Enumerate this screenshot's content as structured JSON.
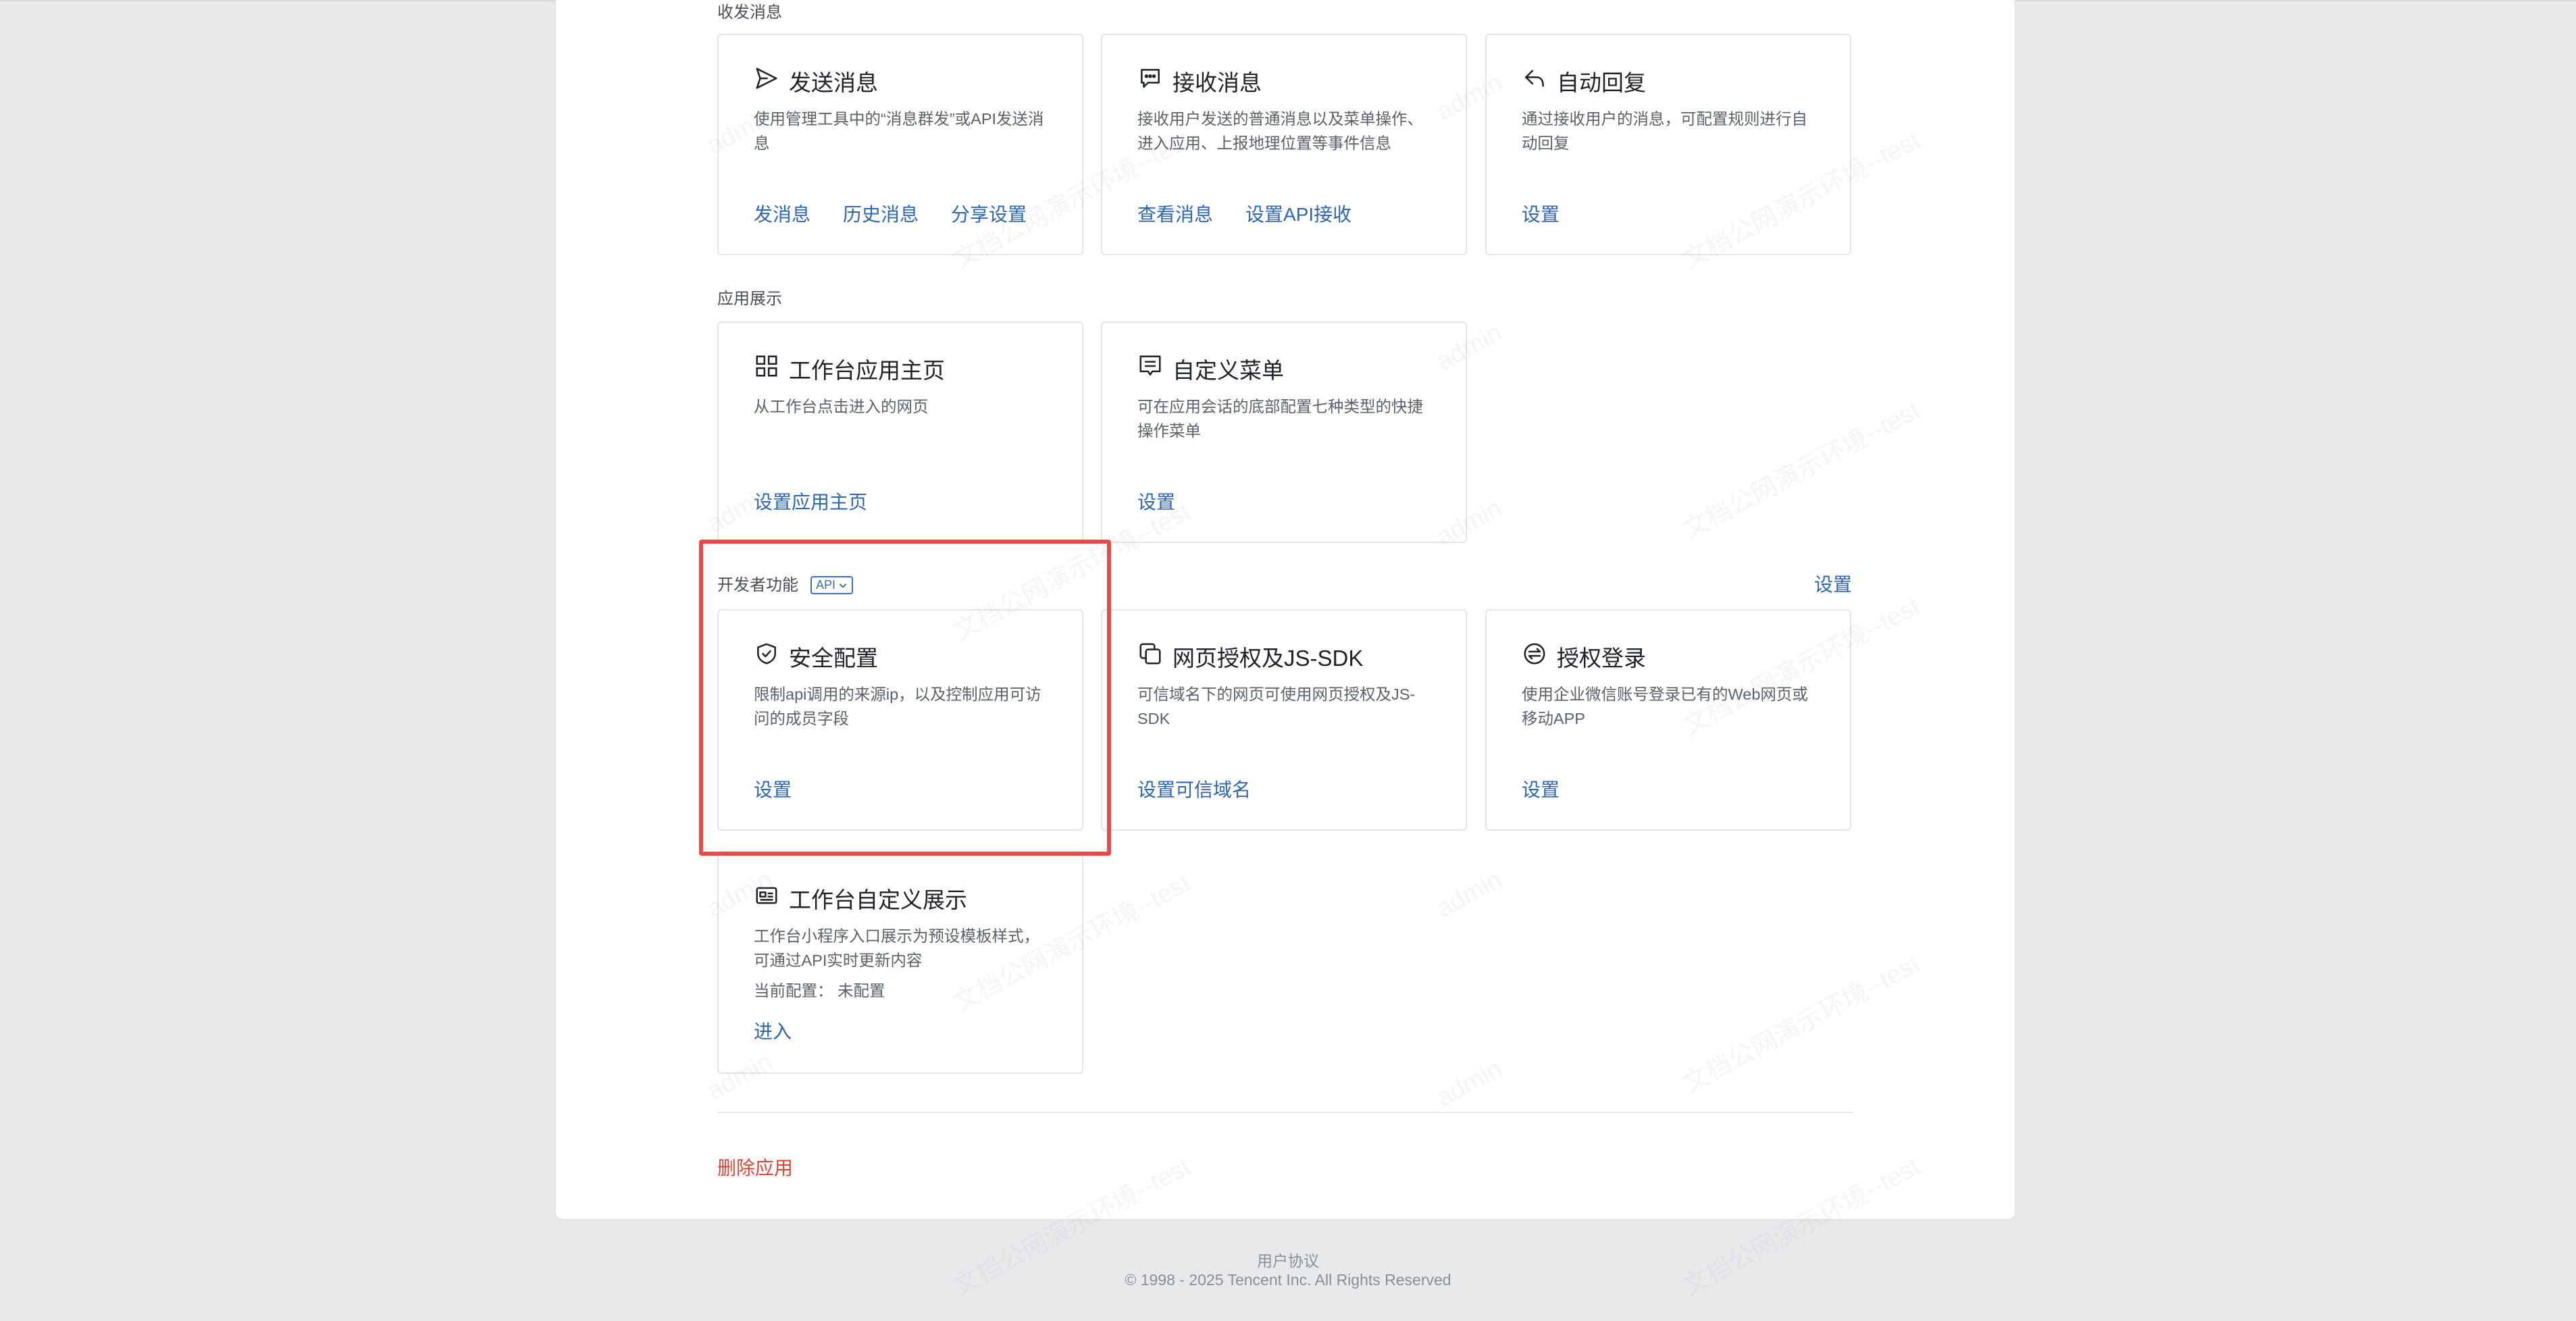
{
  "sections": {
    "messaging": "收发消息",
    "display": "应用展示",
    "developer": "开发者功能",
    "developer_badge": "API",
    "developer_settings": "设置"
  },
  "cards": {
    "send": {
      "title": "发送消息",
      "desc": "使用管理工具中的“消息群发”或API发送消息",
      "links": [
        "发消息",
        "历史消息",
        "分享设置"
      ]
    },
    "receive": {
      "title": "接收消息",
      "desc": "接收用户发送的普通消息以及菜单操作、进入应用、上报地理位置等事件信息",
      "links": [
        "查看消息",
        "设置API接收"
      ]
    },
    "autoreply": {
      "title": "自动回复",
      "desc": "通过接收用户的消息，可配置规则进行自动回复",
      "links": [
        "设置"
      ]
    },
    "homepage": {
      "title": "工作台应用主页",
      "desc": "从工作台点击进入的网页",
      "links": [
        "设置应用主页"
      ]
    },
    "menu": {
      "title": "自定义菜单",
      "desc": "可在应用会话的底部配置七种类型的快捷操作菜单",
      "links": [
        "设置"
      ]
    },
    "security": {
      "title": "安全配置",
      "desc": "限制api调用的来源ip，以及控制应用可访问的成员字段",
      "links": [
        "设置"
      ]
    },
    "oauth": {
      "title": "网页授权及JS-SDK",
      "desc": "可信域名下的网页可使用网页授权及JS-SDK",
      "links": [
        "设置可信域名"
      ]
    },
    "login": {
      "title": "授权登录",
      "desc": "使用企业微信账号登录已有的Web网页或移动APP",
      "links": [
        "设置"
      ]
    },
    "workbench": {
      "title": "工作台自定义展示",
      "desc": "工作台小程序入口展示为预设模板样式，可通过API实时更新内容",
      "meta_label": "当前配置：",
      "meta_value": "未配置",
      "links": [
        "进入"
      ]
    }
  },
  "delete_app": "删除应用",
  "footer": {
    "agreement": "用户协议",
    "copyright": "© 1998 - 2025 Tencent Inc. All Rights Reserved"
  },
  "watermark": {
    "text": "文档公网演示环境--test",
    "user": "admin"
  },
  "colors": {
    "link": "#2f66b0",
    "danger": "#d9443a",
    "highlight": "#e84a4a"
  }
}
